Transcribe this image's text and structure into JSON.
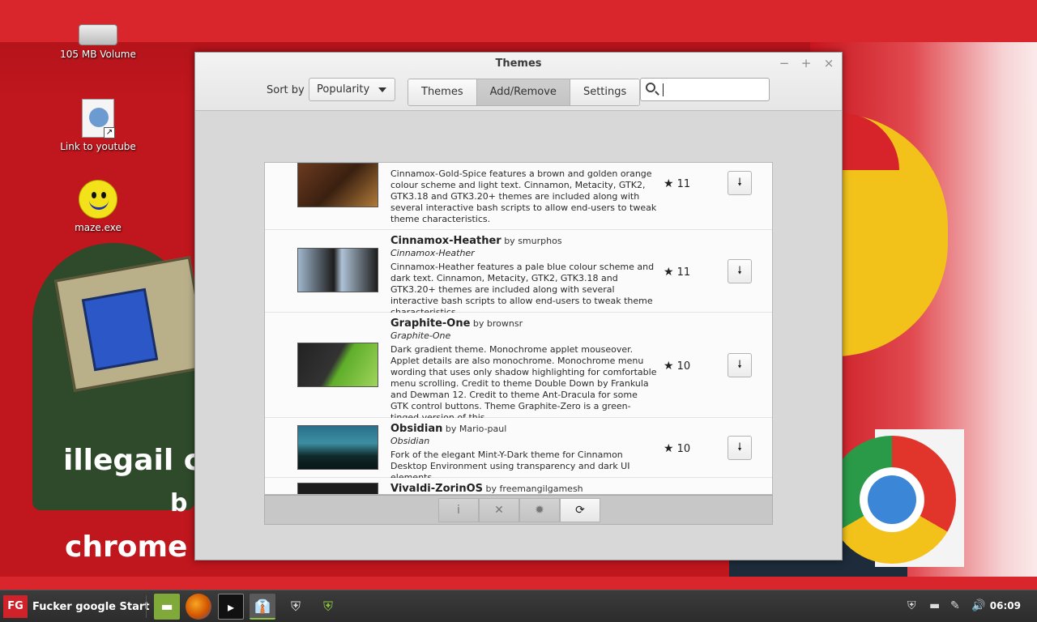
{
  "desktop": {
    "icons": [
      {
        "label": "105 MB Volume",
        "icon": "usb-drive-icon"
      },
      {
        "label": "Link to youtube",
        "icon": "web-link-icon"
      },
      {
        "label": "maze.exe",
        "icon": "smiley-icon"
      }
    ],
    "wallpaper_text": [
      "illegail c",
      "b",
      "chrome s"
    ]
  },
  "window": {
    "title": "Themes",
    "controls": {
      "minimize": "−",
      "maximize": "+",
      "close": "×"
    },
    "tabs": [
      "Themes",
      "Add/Remove",
      "Settings"
    ],
    "active_tab": "Add/Remove",
    "sort_label": "Sort by",
    "sort_value": "Popularity",
    "search_value": ""
  },
  "themes": [
    {
      "name": "",
      "author": "",
      "subtitle": "",
      "description": "Cinnamox-Gold-Spice features a brown and golden orange colour scheme and light text. Cinnamon, Metacity, GTK2, GTK3.18 and GTK3.20+ themes are included along with several interactive bash scripts to allow end-users to tweak theme characteristics.",
      "rating": "11"
    },
    {
      "name": "Cinnamox-Heather",
      "author": "by smurphos",
      "subtitle": "Cinnamox-Heather",
      "description": "Cinnamox-Heather features a pale blue colour scheme and dark text. Cinnamon, Metacity, GTK2, GTK3.18 and GTK3.20+ themes are included along with several interactive bash scripts to allow end-users to tweak theme characteristics.",
      "rating": "11"
    },
    {
      "name": "Graphite-One",
      "author": "by brownsr",
      "subtitle": "Graphite-One",
      "description": "Dark gradient theme. Monochrome applet mouseover. Applet details are also monochrome. Monochrome menu wording that uses only shadow highlighting for comfortable menu scrolling. Credit to theme Double Down by Frankula and Dewman 12. Credit to theme Ant-Dracula for some GTK control buttons. Theme Graphite-Zero is a green-tinged version of this.",
      "rating": "10"
    },
    {
      "name": "Obsidian",
      "author": "by Mario-paul",
      "subtitle": "Obsidian",
      "description": "Fork of the elegant Mint-Y-Dark theme for Cinnamon Desktop Environment using transparency and dark UI elements.",
      "rating": "10"
    },
    {
      "name": "Vivaldi-ZorinOS",
      "author": "by freemangilgamesh",
      "subtitle": "",
      "description": "",
      "rating": ""
    }
  ],
  "list_toolbar": [
    {
      "icon": "info-icon",
      "glyph": "i"
    },
    {
      "icon": "remove-icon",
      "glyph": "✕"
    },
    {
      "icon": "configure-gear-icon",
      "glyph": "✹"
    },
    {
      "icon": "refresh-icon",
      "glyph": "⟳"
    }
  ],
  "taskbar": {
    "start_logo": "FG",
    "start_label": "Fucker google Start",
    "clock": "06:09"
  },
  "colors": {
    "wallpaper_red": "#c0161d",
    "taskbar": "#2f2f2f",
    "accent_green": "#8cc63f"
  }
}
